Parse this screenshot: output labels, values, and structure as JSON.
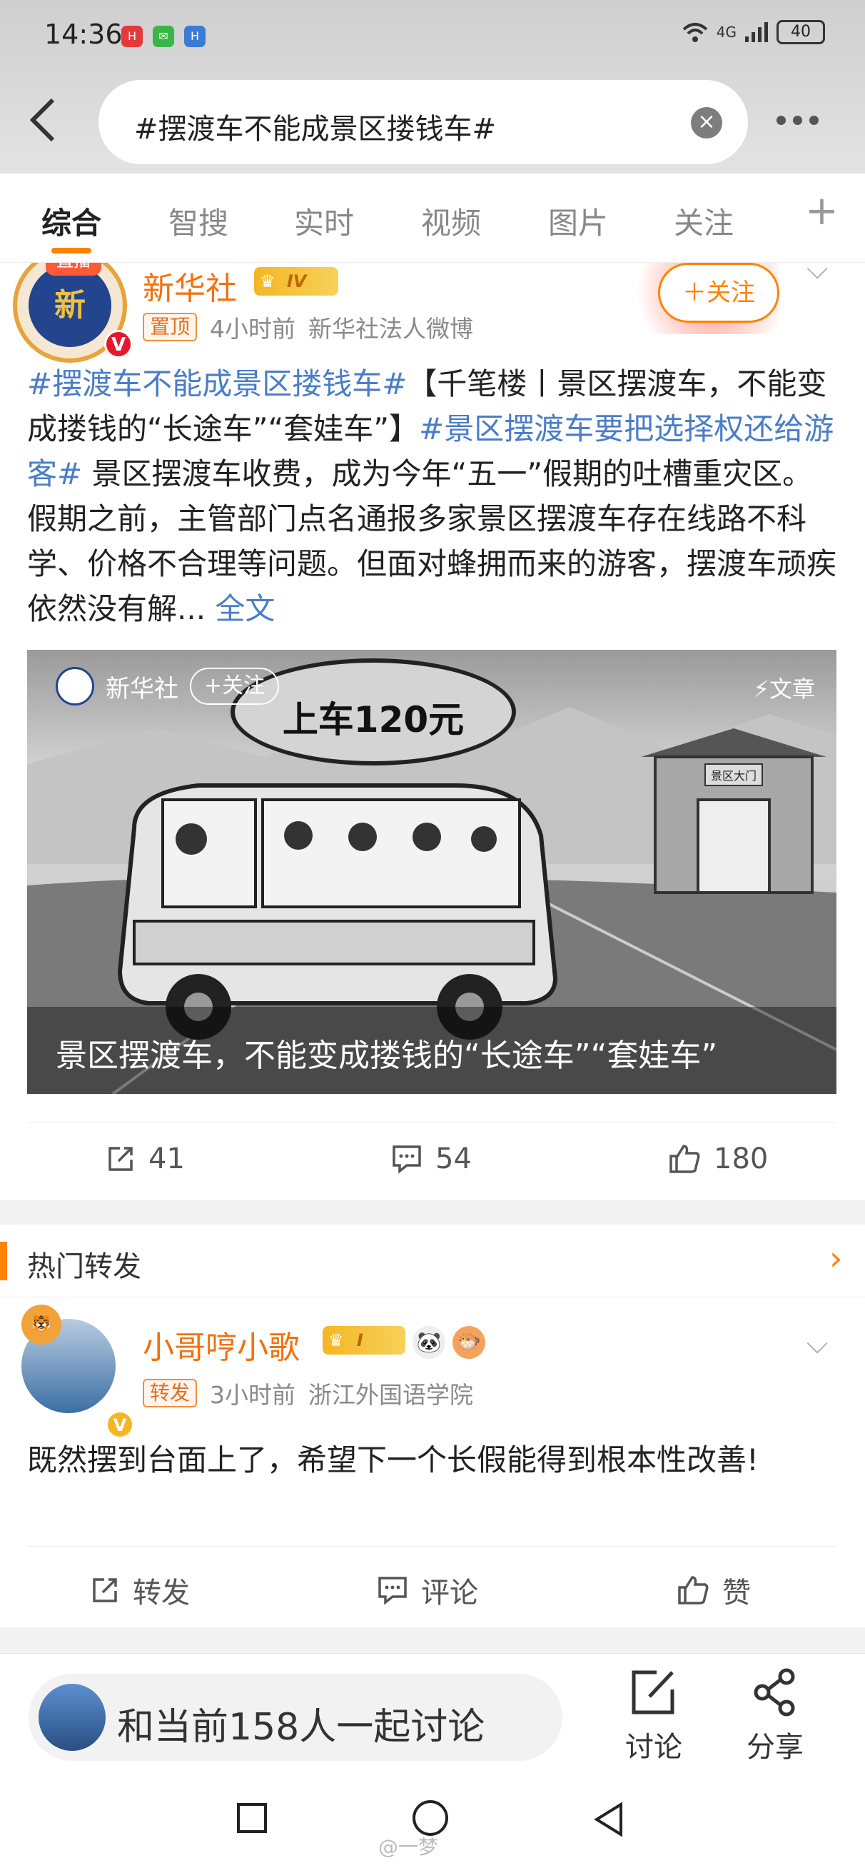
{
  "status_bar": {
    "time": "14:36",
    "network": "4G",
    "battery": "40"
  },
  "header": {
    "search_query": "#摆渡车不能成景区搂钱车#"
  },
  "tabs": [
    {
      "label": "综合",
      "active": true
    },
    {
      "label": "智搜",
      "active": false
    },
    {
      "label": "实时",
      "active": false
    },
    {
      "label": "视频",
      "active": false
    },
    {
      "label": "图片",
      "active": false
    },
    {
      "label": "关注",
      "active": false
    }
  ],
  "post1": {
    "avatar_live": "直播",
    "author": "新华社",
    "level": "IV",
    "pinned": "置顶",
    "time": "4小时前",
    "source": "新华社法人微博",
    "follow": "＋关注",
    "body": {
      "tag1": "#摆渡车不能成景区搂钱车#",
      "text1": "【千笔楼丨景区摆渡车，不能变成搂钱的“长途车”“套娃车”】",
      "tag2": "#景区摆渡车要把选择权还给游客#",
      "text2": " 景区摆渡车收费，成为今年“五一”假期的吐槽重灾区。假期之前，主管部门点名通报多家景区摆渡车存在线路不科学、价格不合理等问题。但面对蜂拥而来的游客，摆渡车顽疾依然没有解...",
      "full": "全文"
    },
    "media": {
      "source_name": "新华社",
      "source_follow": "+关注",
      "type_label": "文章",
      "bubble": "上车120元",
      "gate_label": "景区大门",
      "caption": "景区摆渡车，不能变成搂钱的“长途车”“套娃车”"
    },
    "counts": {
      "reposts": "41",
      "comments": "54",
      "likes": "180"
    }
  },
  "hot_reposts": {
    "title": "热门转发"
  },
  "post2": {
    "author": "小哥哼小歌",
    "level": "I",
    "tag": "转发",
    "time": "3小时前",
    "source": "浙江外国语学院",
    "body": "既然摆到台面上了，希望下一个长假能得到根本性改善!",
    "actions": {
      "repost": "转发",
      "comment": "评论",
      "like": "赞"
    }
  },
  "bottom_bar": {
    "discuss_text": "和当前158人一起讨论",
    "discuss_btn": "讨论",
    "share_btn": "分享"
  },
  "watermark": "@一梦",
  "colors": {
    "accent": "#ff8200",
    "link": "#4a7dc8",
    "author": "#f5700d"
  }
}
